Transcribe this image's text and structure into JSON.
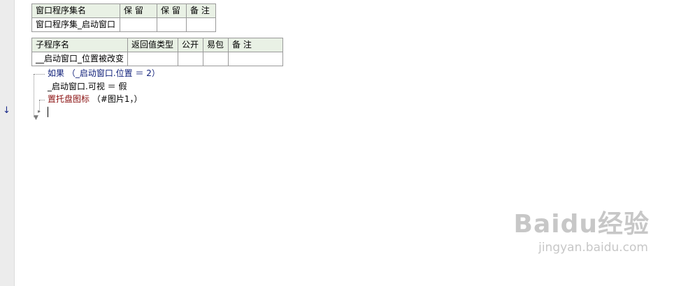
{
  "gutter": {
    "arrow_glyph": "↓"
  },
  "module_table": {
    "headers": [
      "窗口程序集名",
      "保 留",
      "保 留",
      "备 注"
    ],
    "row": [
      "窗口程序集_启动窗口",
      "",
      "",
      ""
    ]
  },
  "sub_table": {
    "headers": [
      "子程序名",
      "返回值类型",
      "公开",
      "易包",
      "备 注"
    ],
    "row": [
      "__启动窗口_位置被改变",
      "",
      "",
      "",
      ""
    ]
  },
  "code": {
    "line1": "如果 （_启动窗口.位置 ＝ 2）",
    "line2": "_启动窗口.可视 ＝ 假",
    "line3_cmd": "置托盘图标",
    "line3_args": "（#图片1，）"
  },
  "watermark": {
    "logo": "Baidu经验",
    "url": "jingyan.baidu.com"
  }
}
